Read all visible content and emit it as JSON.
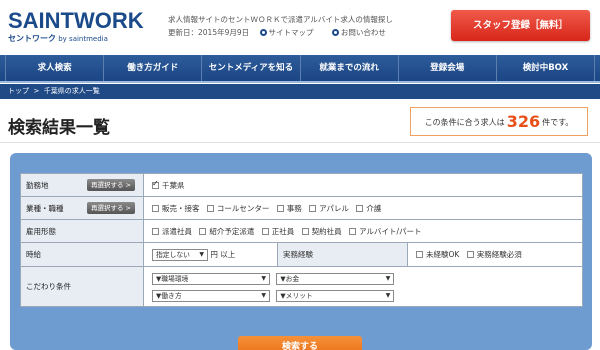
{
  "header": {
    "logo_main": "SAINTWORK",
    "logo_sub_jp": "セントワーク",
    "logo_sub_by": "by saintmedia",
    "tagline": "求人情報サイトのセントＷＯＲＫで派遣アルバイト求人の情報探し",
    "updated": "更新日：2015年9月9日",
    "sitemap_label": "サイトマップ",
    "contact_label": "お問い合わせ",
    "signup_label": "スタッフ登録［無料］"
  },
  "nav": {
    "items": [
      "求人検索",
      "働き方ガイド",
      "セントメディアを知る",
      "就業までの流れ",
      "登録会場",
      "検討中BOX"
    ]
  },
  "breadcrumb": {
    "home": "トップ",
    "separator": ">",
    "current": "千葉県の求人一覧"
  },
  "results": {
    "title": "検索結果一覧",
    "count_prefix": "この条件に合う求人は",
    "count": "326",
    "count_suffix": "件です。"
  },
  "form": {
    "reselect_label": "再選択する >",
    "rows": {
      "location": {
        "label": "勤務地",
        "options": [
          {
            "label": "千葉県",
            "checked": true
          }
        ]
      },
      "job_type": {
        "label": "業種・職種",
        "options": [
          {
            "label": "販売・接客",
            "checked": false
          },
          {
            "label": "コールセンター",
            "checked": false
          },
          {
            "label": "事務",
            "checked": false
          },
          {
            "label": "アパレル",
            "checked": false
          },
          {
            "label": "介護",
            "checked": false
          }
        ]
      },
      "employment": {
        "label": "雇用形態",
        "options": [
          {
            "label": "派遣社員",
            "checked": false
          },
          {
            "label": "紹介予定派遣",
            "checked": false
          },
          {
            "label": "正社員",
            "checked": false
          },
          {
            "label": "契約社員",
            "checked": false
          },
          {
            "label": "アルバイト/パート",
            "checked": false
          }
        ]
      },
      "wage": {
        "label": "時給",
        "select_value": "指定しない",
        "unit": "円 以上"
      },
      "experience": {
        "label": "実務経験",
        "options": [
          {
            "label": "未経験OK",
            "checked": false
          },
          {
            "label": "実務経験必須",
            "checked": false
          }
        ]
      },
      "preferences": {
        "label": "こだわり条件",
        "selects": [
          "▼職場環境",
          "▼お金",
          "▼働き方",
          "▼メリット"
        ]
      }
    },
    "submit_label": "検索する"
  },
  "colors": {
    "brand_blue": "#1a4a8a",
    "signup_red": "#d8261a",
    "count_orange": "#e8501a",
    "panel_blue": "#6e9bd0",
    "search_orange": "#e86a10"
  }
}
